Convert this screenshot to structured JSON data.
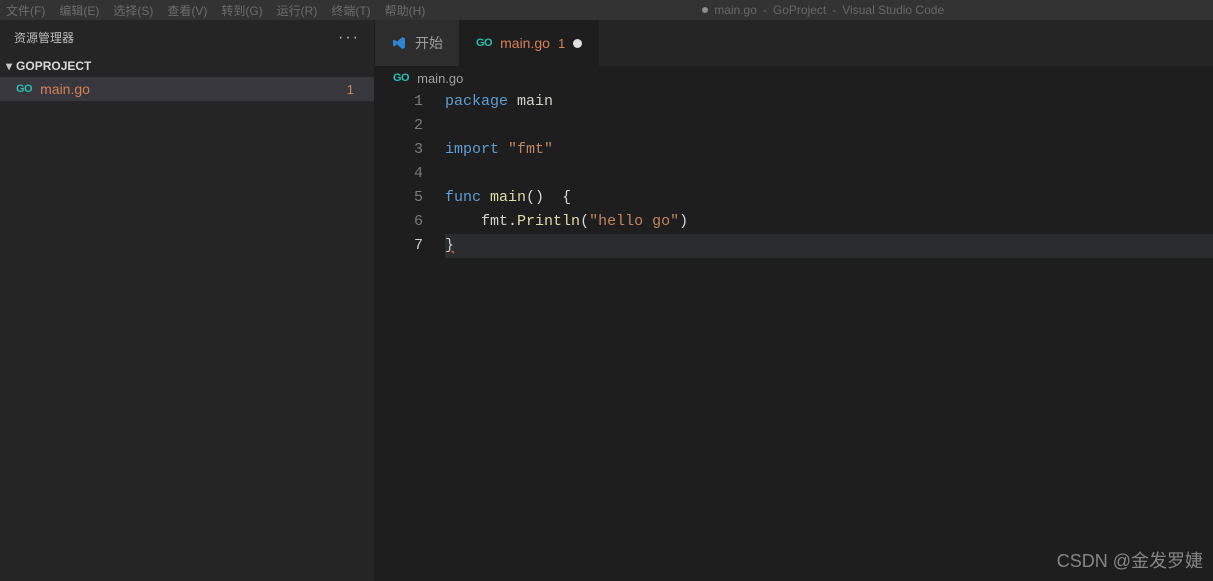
{
  "menubar": {
    "items": [
      "文件(F)",
      "编辑(E)",
      "选择(S)",
      "查看(V)",
      "转到(G)",
      "运行(R)",
      "终端(T)",
      "帮助(H)"
    ],
    "modified_indicator": "●",
    "title_parts": [
      "main.go",
      "GoProject",
      "Visual Studio Code"
    ]
  },
  "sidebar": {
    "title": "资源管理器",
    "more_label": "···",
    "project": "GOPROJECT",
    "file": {
      "icon": "GO",
      "name": "main.go",
      "badge": "1"
    }
  },
  "tabs": {
    "start": {
      "label": "开始"
    },
    "file": {
      "icon": "GO",
      "label": "main.go",
      "count": "1"
    }
  },
  "breadcrumb": {
    "icon": "GO",
    "label": "main.go"
  },
  "code": {
    "lines": [
      {
        "n": 1,
        "tokens": [
          [
            "kw",
            "package"
          ],
          [
            "sp",
            " "
          ],
          [
            "ident",
            "main"
          ]
        ]
      },
      {
        "n": 2,
        "tokens": []
      },
      {
        "n": 3,
        "tokens": [
          [
            "kw",
            "import"
          ],
          [
            "sp",
            " "
          ],
          [
            "str",
            "\"fmt\""
          ]
        ]
      },
      {
        "n": 4,
        "tokens": []
      },
      {
        "n": 5,
        "tokens": [
          [
            "kw",
            "func"
          ],
          [
            "sp",
            " "
          ],
          [
            "func",
            "main"
          ],
          [
            "punc",
            "()"
          ],
          [
            "sp",
            "  "
          ],
          [
            "punc",
            "{"
          ]
        ]
      },
      {
        "n": 6,
        "tokens": [
          [
            "sp",
            "    "
          ],
          [
            "ident",
            "fmt"
          ],
          [
            "punc",
            "."
          ],
          [
            "func",
            "Println"
          ],
          [
            "punc",
            "("
          ],
          [
            "str",
            "\"hello go\""
          ],
          [
            "punc",
            ")"
          ]
        ]
      },
      {
        "n": 7,
        "current": true,
        "tokens": [
          [
            "err",
            "}"
          ]
        ]
      }
    ]
  },
  "watermark": "CSDN @金发罗婕"
}
